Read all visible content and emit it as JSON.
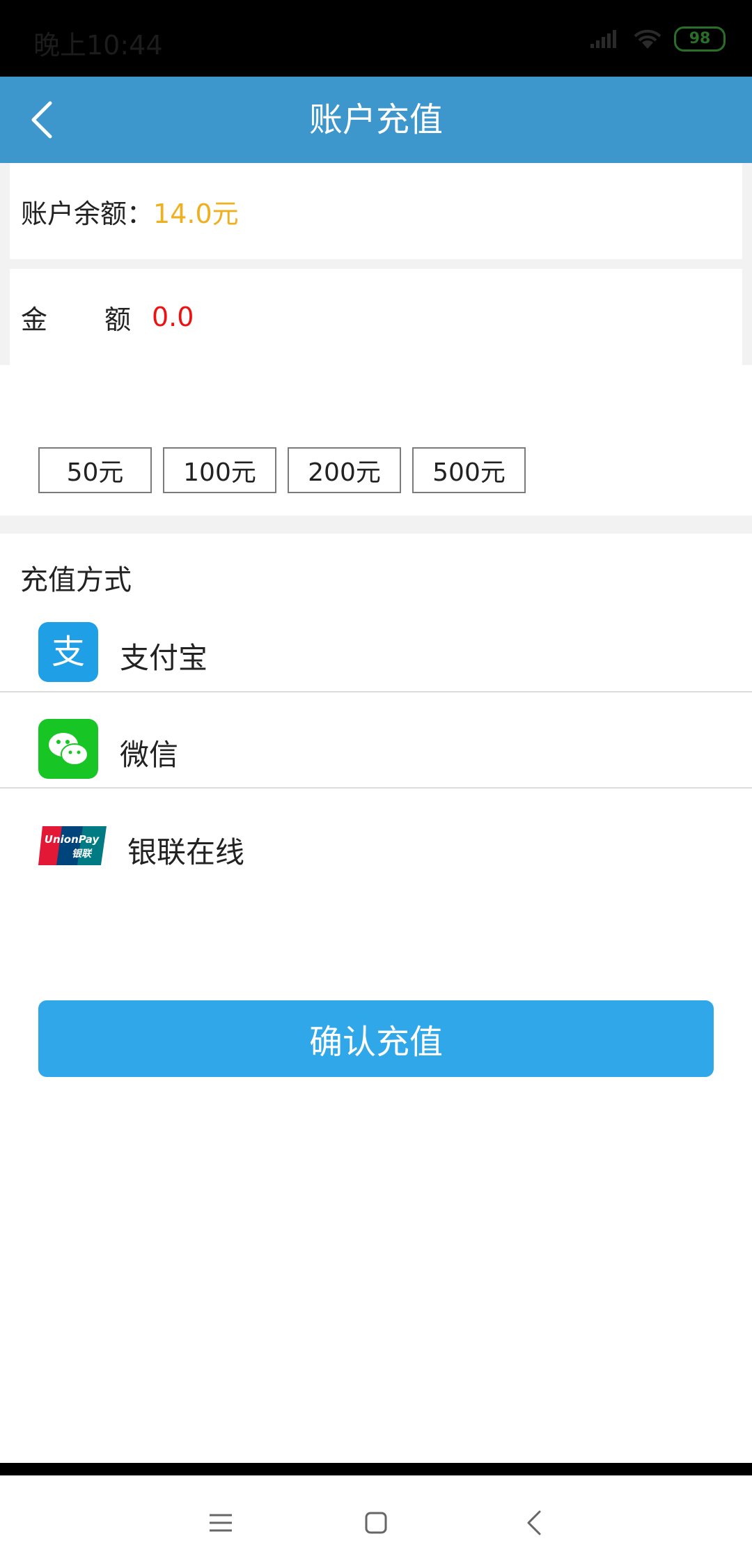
{
  "status_bar": {
    "time": "晚上10:44",
    "battery": "98"
  },
  "header": {
    "title": "账户充值",
    "back_icon": "chevron-left-icon"
  },
  "balance": {
    "label": "账户余额：",
    "value": "14.0元"
  },
  "amount": {
    "label": "金额",
    "value": "0.0"
  },
  "quick_amounts": [
    "50元",
    "100元",
    "200元",
    "500元"
  ],
  "payment": {
    "section_title": "充值方式",
    "methods": [
      {
        "label": "支付宝",
        "icon": "alipay-icon"
      },
      {
        "label": "微信",
        "icon": "wechat-icon"
      },
      {
        "label": "银联在线",
        "icon": "unionpay-icon"
      }
    ]
  },
  "confirm_button": "确认充值",
  "colors": {
    "app_bar": "#3e97cc",
    "balance_value": "#eeb01e",
    "amount_value": "#ee1111",
    "confirm_button": "#2fa7e8",
    "alipay": "#1e9fe6",
    "wechat": "#17c624"
  },
  "nav_bar": {
    "menu_icon": "menu-icon",
    "home_icon": "home-square-icon",
    "back_icon": "back-triangle-icon"
  }
}
